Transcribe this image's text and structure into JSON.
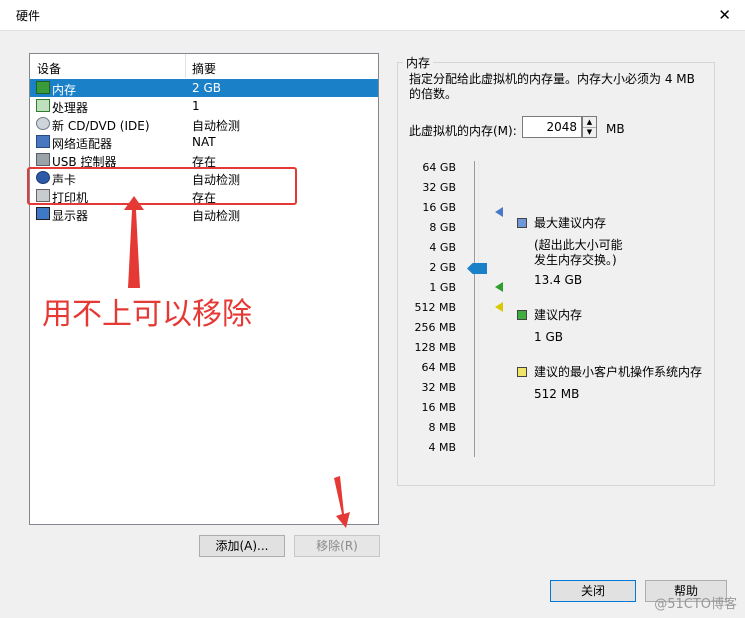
{
  "window": {
    "title": "硬件",
    "close_glyph": "✕"
  },
  "device_list": {
    "header": {
      "device": "设备",
      "summary": "摘要"
    },
    "rows": [
      {
        "icon": "memory-icon",
        "name": "内存",
        "summary": "2 GB",
        "selected": true
      },
      {
        "icon": "cpu-icon",
        "name": "处理器",
        "summary": "1",
        "selected": false
      },
      {
        "icon": "cd-dvd-icon",
        "name": "新 CD/DVD (IDE)",
        "summary": "自动检测",
        "selected": false
      },
      {
        "icon": "network-adapter-icon",
        "name": "网络适配器",
        "summary": "NAT",
        "selected": false
      },
      {
        "icon": "usb-icon",
        "name": "USB 控制器",
        "summary": "存在",
        "selected": false
      },
      {
        "icon": "sound-card-icon",
        "name": "声卡",
        "summary": "自动检测",
        "selected": false
      },
      {
        "icon": "printer-icon",
        "name": "打印机",
        "summary": "存在",
        "selected": false
      },
      {
        "icon": "display-icon",
        "name": "显示器",
        "summary": "自动检测",
        "selected": false
      }
    ]
  },
  "buttons": {
    "add": "添加(A)...",
    "remove": "移除(R)",
    "close": "关闭",
    "help": "帮助"
  },
  "memory": {
    "group_title": "内存",
    "description": "指定分配给此虚拟机的内存量。内存大小必须为 4 MB 的倍数。",
    "input_label": "此虚拟机的内存(M):",
    "value": "2048",
    "unit": "MB",
    "ticks": [
      "64 GB",
      "32 GB",
      "16 GB",
      "8 GB",
      "4 GB",
      "2 GB",
      "1 GB",
      "512 MB",
      "256 MB",
      "128 MB",
      "64 MB",
      "32 MB",
      "16 MB",
      "8 MB",
      "4 MB"
    ],
    "selected_tick": "2 GB",
    "legend": {
      "max": {
        "label": "最大建议内存",
        "note1": "(超出此大小可能",
        "note2": "发生内存交换。)",
        "value": "13.4 GB",
        "color": "#6f98d8"
      },
      "recommended": {
        "label": "建议内存",
        "value": "1 GB",
        "color": "#3fae3f"
      },
      "min_guest": {
        "label": "建议的最小客户机操作系统内存",
        "value": "512 MB",
        "color": "#f0e66a"
      }
    }
  },
  "annotation": {
    "text": "用不上可以移除",
    "color": "#e53935"
  },
  "watermark": "@51CTO博客"
}
